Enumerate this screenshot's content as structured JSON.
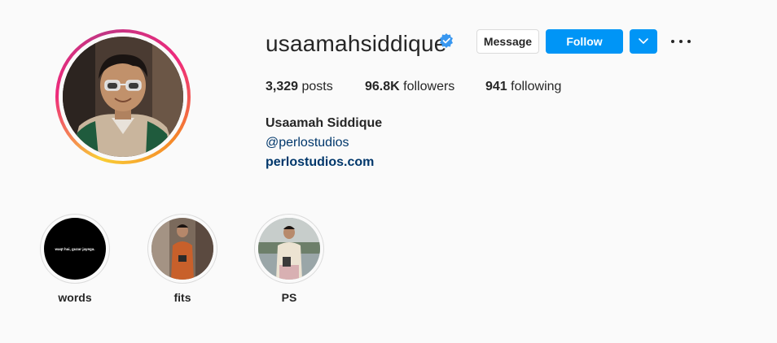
{
  "profile": {
    "username": "usaamahsiddique",
    "verified": true,
    "full_name": "Usaamah Siddique",
    "handle_link": "@perlostudios",
    "website": "perlostudios.com"
  },
  "actions": {
    "message_label": "Message",
    "follow_label": "Follow",
    "dropdown_icon": "chevron-down-icon",
    "more_icon": "more-options-icon"
  },
  "stats": {
    "posts_count": "3,329",
    "posts_label": "posts",
    "followers_count": "96.8K",
    "followers_label": "followers",
    "following_count": "941",
    "following_label": "following"
  },
  "highlights": [
    {
      "label": "words",
      "cover_text": "waqt hai, guzar jayega."
    },
    {
      "label": "fits"
    },
    {
      "label": "PS"
    }
  ],
  "colors": {
    "primary_blue": "#0095f6",
    "link_blue": "#00376b",
    "text": "#262626",
    "background": "#fafafa",
    "border": "#dbdbdb"
  }
}
